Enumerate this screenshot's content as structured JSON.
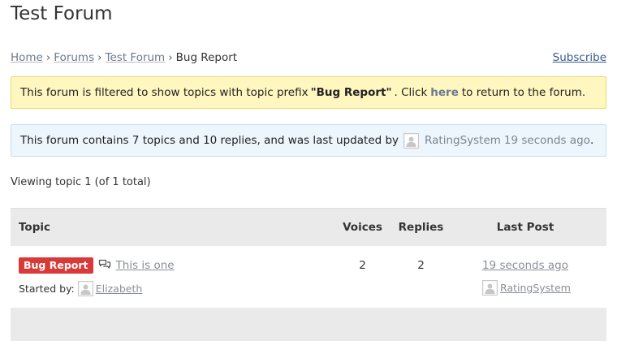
{
  "forum": {
    "title": "Test Forum"
  },
  "breadcrumb": {
    "items": [
      "Home",
      "Forums",
      "Test Forum"
    ],
    "separator": "›",
    "current": "Bug Report"
  },
  "subscribe_label": "Subscribe",
  "filter_notice": {
    "text_before": "This forum is filtered to show topics with topic prefix",
    "prefix": "\"Bug Report\"",
    "text_middle": ". Click",
    "link": "here",
    "text_after": "to return to the forum."
  },
  "info_notice": {
    "text": "This forum contains 7 topics and 10 replies, and was last updated by",
    "user": "RatingSystem",
    "time": "19 seconds ago",
    "end": "."
  },
  "viewing_text": "Viewing topic 1 (of 1 total)",
  "table": {
    "headers": {
      "topic": "Topic",
      "voices": "Voices",
      "replies": "Replies",
      "last_post": "Last Post"
    },
    "rows": [
      {
        "prefix": "Bug Report",
        "title": "This is one",
        "started_by_label": "Started by:",
        "author": "Elizabeth",
        "voices": "2",
        "replies": "2",
        "freshness": "19 seconds ago",
        "last_author": "RatingSystem"
      }
    ]
  },
  "colors": {
    "prefix_badge": "#d93939",
    "filter_notice_bg": "#fff7bf",
    "info_notice_bg": "#eef6fd",
    "table_header_bg": "#eaeaea"
  },
  "icons": {
    "avatar": "avatar-placeholder-icon",
    "topic": "chat-bubbles-icon"
  }
}
